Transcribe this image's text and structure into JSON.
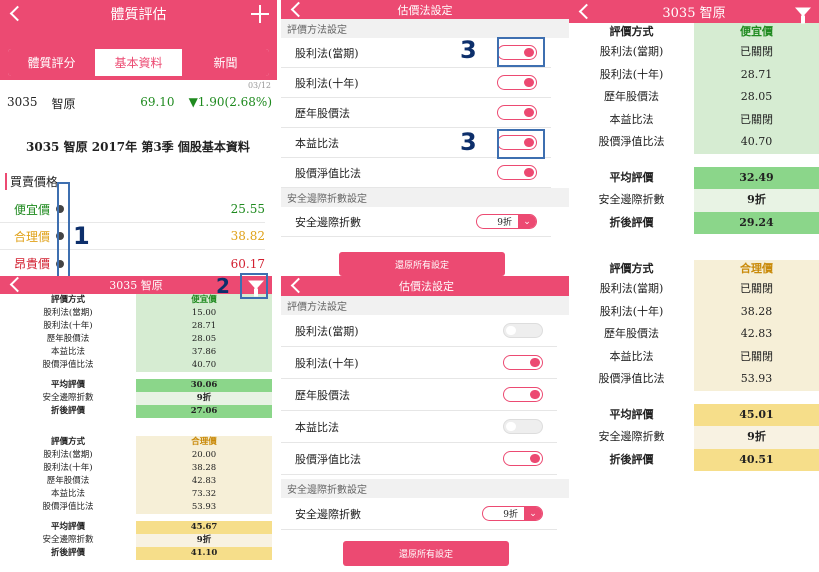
{
  "p1": {
    "title": "體質評估",
    "tabs": [
      "體質評分",
      "基本資料",
      "新聞"
    ],
    "active_tab": 1,
    "date": "03/12",
    "code": "3035",
    "name": "智原",
    "price": "69.10",
    "change": "▼1.90(2.68%)",
    "headline": "3035 智原 2017年 第3季 個股基本資料",
    "section": "買賣價格",
    "prices": [
      {
        "label": "便宜價",
        "value": "25.55",
        "color": "#1f8a1f"
      },
      {
        "label": "合理價",
        "value": "38.82",
        "color": "#e0a21a"
      },
      {
        "label": "昂貴價",
        "value": "60.17",
        "color": "#d21f2f"
      }
    ]
  },
  "p2": {
    "title": "3035 智原",
    "cheap": {
      "header": [
        "評價方式",
        "便宜價"
      ],
      "rows": [
        [
          "股利法(當期)",
          "15.00"
        ],
        [
          "股利法(十年)",
          "28.71"
        ],
        [
          "歷年股價法",
          "28.05"
        ],
        [
          "本益比法",
          "37.86"
        ],
        [
          "股價淨值比法",
          "40.70"
        ]
      ],
      "summary": [
        [
          "平均評價",
          "30.06"
        ],
        [
          "安全邊際折數",
          "9折"
        ],
        [
          "折後評價",
          "27.06"
        ]
      ]
    },
    "fair": {
      "header": [
        "評價方式",
        "合理價"
      ],
      "rows": [
        [
          "股利法(當期)",
          "20.00"
        ],
        [
          "股利法(十年)",
          "38.28"
        ],
        [
          "歷年股價法",
          "42.83"
        ],
        [
          "本益比法",
          "73.32"
        ],
        [
          "股價淨值比法",
          "53.93"
        ]
      ],
      "summary": [
        [
          "平均評價",
          "45.67"
        ],
        [
          "安全邊際折數",
          "9折"
        ],
        [
          "折後評價",
          "41.10"
        ]
      ]
    }
  },
  "p3": {
    "title": "估價法設定",
    "section1": "評價方法設定",
    "methods": [
      {
        "label": "股利法(當期)",
        "on": true
      },
      {
        "label": "股利法(十年)",
        "on": true
      },
      {
        "label": "歷年股價法",
        "on": true
      },
      {
        "label": "本益比法",
        "on": true
      },
      {
        "label": "股價淨值比法",
        "on": true
      }
    ],
    "section2": "安全邊際折數設定",
    "margin_label": "安全邊際折數",
    "margin_value": "9折",
    "reset": "還原所有設定"
  },
  "p4": {
    "title": "估價法設定",
    "section1": "評價方法設定",
    "methods": [
      {
        "label": "股利法(當期)",
        "on": false
      },
      {
        "label": "股利法(十年)",
        "on": true
      },
      {
        "label": "歷年股價法",
        "on": true
      },
      {
        "label": "本益比法",
        "on": false
      },
      {
        "label": "股價淨值比法",
        "on": true
      }
    ],
    "section2": "安全邊際折數設定",
    "margin_label": "安全邊際折數",
    "margin_value": "9折",
    "reset": "還原所有設定"
  },
  "p5": {
    "title": "3035 智原",
    "cheap": {
      "header": [
        "評價方式",
        "便宜價"
      ],
      "rows": [
        [
          "股利法(當期)",
          "已關閉"
        ],
        [
          "股利法(十年)",
          "28.71"
        ],
        [
          "歷年股價法",
          "28.05"
        ],
        [
          "本益比法",
          "已關閉"
        ],
        [
          "股價淨值比法",
          "40.70"
        ]
      ],
      "summary": [
        [
          "平均評價",
          "32.49"
        ],
        [
          "安全邊際折數",
          "9折"
        ],
        [
          "折後評價",
          "29.24"
        ]
      ]
    },
    "fair": {
      "header": [
        "評價方式",
        "合理價"
      ],
      "rows": [
        [
          "股利法(當期)",
          "已關閉"
        ],
        [
          "股利法(十年)",
          "38.28"
        ],
        [
          "歷年股價法",
          "42.83"
        ],
        [
          "本益比法",
          "已關閉"
        ],
        [
          "股價淨值比法",
          "53.93"
        ]
      ],
      "summary": [
        [
          "平均評價",
          "45.01"
        ],
        [
          "安全邊際折數",
          "9折"
        ],
        [
          "折後評價",
          "40.51"
        ]
      ]
    }
  },
  "annotations": [
    "1",
    "2",
    "3",
    "3"
  ],
  "colors": {
    "accent": "#ec4a72",
    "marker": "#3e6fb0"
  }
}
